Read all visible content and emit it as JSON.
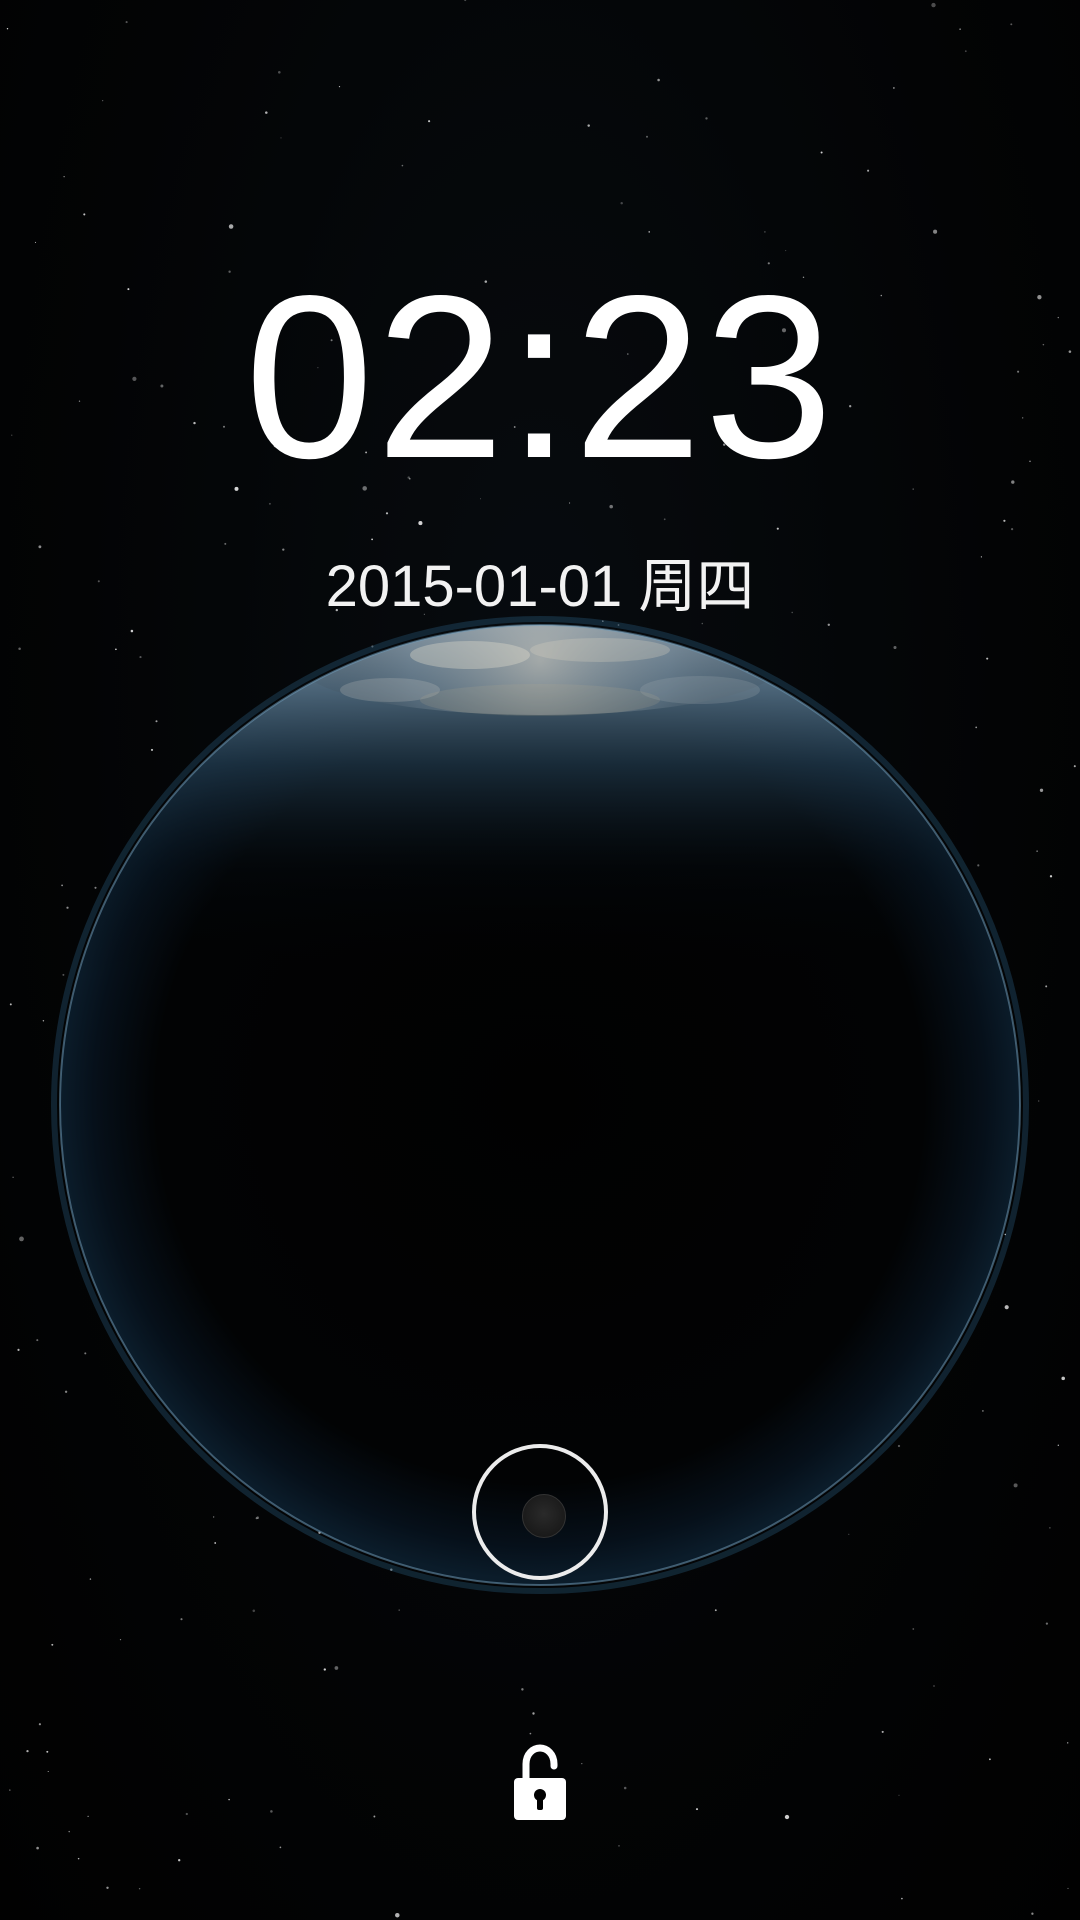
{
  "lockscreen": {
    "time": "02:23",
    "date": "2015-01-01 周四"
  },
  "icons": {
    "unlock_handle": "unlock-ring-icon",
    "lock": "unlocked-padlock-icon"
  },
  "colors": {
    "text": "#ffffff",
    "background": "#020304",
    "ring": "#ececec"
  }
}
